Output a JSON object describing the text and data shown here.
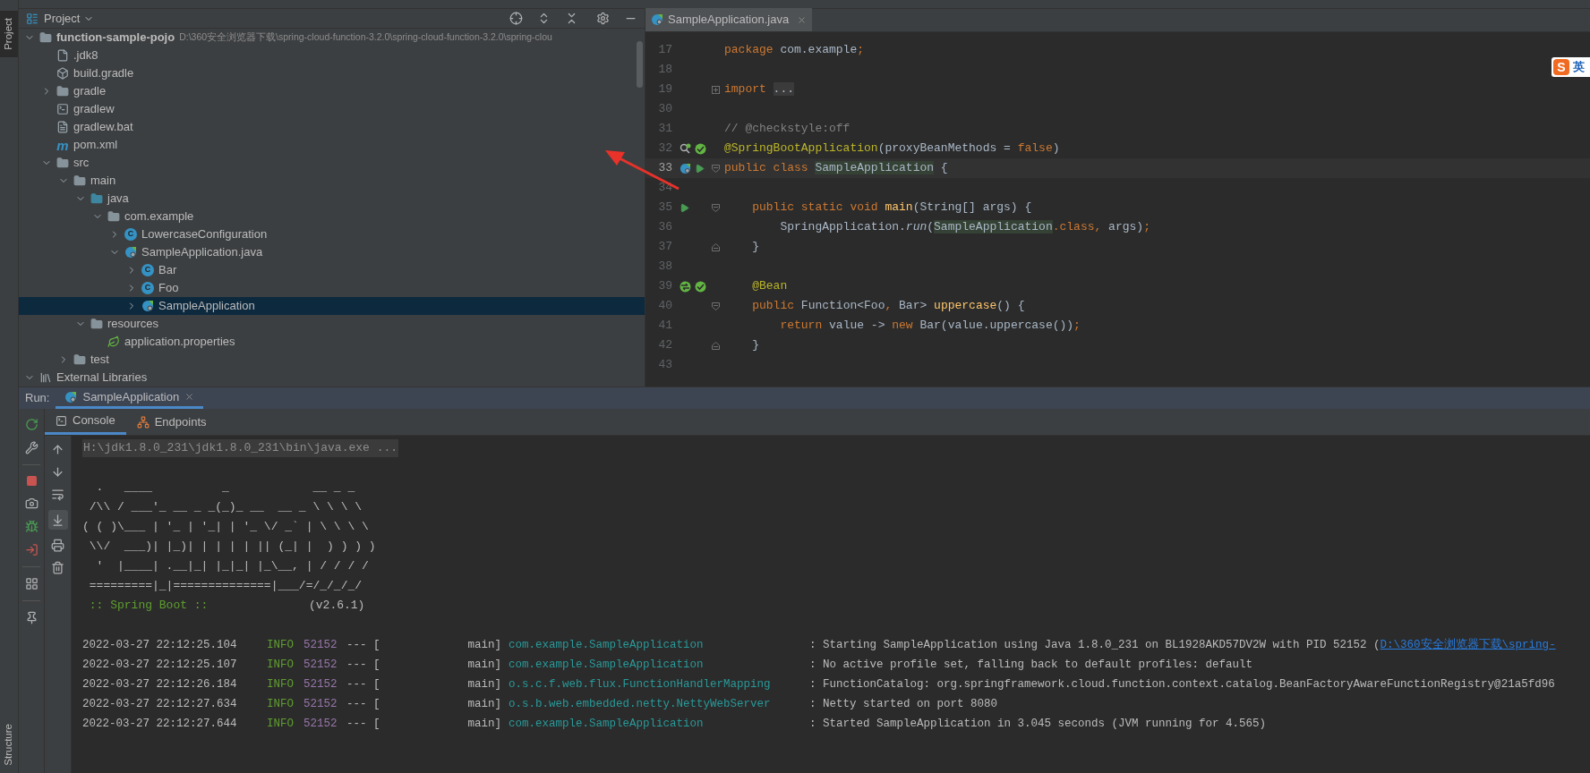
{
  "left_strip": {
    "top": [
      {
        "label": "Project",
        "selected": true
      }
    ],
    "bottom": [
      {
        "label": "Structure",
        "selected": false
      }
    ]
  },
  "project": {
    "title": "Project",
    "tree": [
      {
        "label": "function-sample-pojo",
        "kind": "module",
        "path": "D:\\360安全浏览器下载\\spring-cloud-function-3.2.0\\spring-cloud-function-3.2.0\\spring-clou",
        "expanded": true,
        "selected": false,
        "children": [
          {
            "label": ".jdk8",
            "kind": "sdk",
            "selected": false
          },
          {
            "label": "build.gradle",
            "kind": "gradle",
            "selected": false
          },
          {
            "label": "gradle",
            "kind": "folder",
            "expanded": false,
            "selected": false
          },
          {
            "label": "gradlew",
            "kind": "script",
            "selected": false
          },
          {
            "label": "gradlew.bat",
            "kind": "file",
            "selected": false
          },
          {
            "label": "pom.xml",
            "kind": "maven",
            "icon_letter": "m",
            "selected": false
          },
          {
            "label": "src",
            "kind": "folder",
            "expanded": true,
            "selected": false,
            "children": [
              {
                "label": "main",
                "kind": "folder",
                "expanded": true,
                "selected": false,
                "children": [
                  {
                    "label": "java",
                    "kind": "source-folder",
                    "expanded": true,
                    "selected": false,
                    "children": [
                      {
                        "label": "com.example",
                        "kind": "package",
                        "expanded": true,
                        "selected": false,
                        "children": [
                          {
                            "label": "LowercaseConfiguration",
                            "kind": "class",
                            "icon_letter": "C",
                            "expanded": false,
                            "selected": false
                          },
                          {
                            "label": "SampleApplication.java",
                            "kind": "spring-class",
                            "expanded": true,
                            "selected": false,
                            "children": [
                              {
                                "label": "Bar",
                                "kind": "class",
                                "icon_letter": "C",
                                "expanded": false,
                                "selected": false
                              },
                              {
                                "label": "Foo",
                                "kind": "class",
                                "icon_letter": "C",
                                "expanded": false,
                                "selected": false
                              },
                              {
                                "label": "SampleApplication",
                                "kind": "spring-class",
                                "expanded": false,
                                "selected": true
                              }
                            ]
                          }
                        ]
                      }
                    ]
                  },
                  {
                    "label": "resources",
                    "kind": "resources",
                    "expanded": true,
                    "selected": false,
                    "children": [
                      {
                        "label": "application.properties",
                        "kind": "properties",
                        "selected": false
                      }
                    ]
                  }
                ]
              },
              {
                "label": "test",
                "kind": "folder",
                "expanded": false,
                "selected": false
              }
            ]
          }
        ]
      },
      {
        "label": "External Libraries",
        "kind": "libraries",
        "expanded": true,
        "selected": false
      }
    ]
  },
  "editor": {
    "tabs": [
      {
        "label": "SampleApplication.java",
        "selected": true
      }
    ],
    "ime": {
      "logo": "S",
      "mode": "英"
    },
    "lines": [
      {
        "number": "17",
        "current": false,
        "tokens": [
          {
            "text": "package",
            "kind": "keyword"
          },
          {
            "text": " com.example",
            "kind": "plain"
          },
          {
            "text": ";",
            "kind": "keyword"
          }
        ]
      },
      {
        "number": "18",
        "current": false
      },
      {
        "number": "19",
        "current": false,
        "fold": {
          "kind": "collapsed"
        },
        "tokens": [
          {
            "text": "import ",
            "kind": "keyword"
          },
          {
            "text": "...",
            "kind": "folded"
          }
        ]
      },
      {
        "number": "30",
        "current": false
      },
      {
        "number": "31",
        "current": false,
        "tokens": [
          {
            "text": "// @checkstyle:off",
            "kind": "comment"
          }
        ]
      },
      {
        "number": "32",
        "current": false,
        "gutter": [
          {
            "kind": "bean-search"
          },
          {
            "kind": "bean"
          }
        ],
        "tokens": [
          {
            "text": "@SpringBootApplication",
            "kind": "annotation"
          },
          {
            "text": "(proxyBeanMethods = ",
            "kind": "plain"
          },
          {
            "text": "false",
            "kind": "keyword"
          },
          {
            "text": ")",
            "kind": "plain"
          }
        ]
      },
      {
        "number": "33",
        "current": true,
        "gutter": [
          {
            "kind": "spring-app"
          },
          {
            "kind": "run"
          }
        ],
        "fold": {
          "kind": "start"
        },
        "tokens": [
          {
            "text": "public class ",
            "kind": "keyword"
          },
          {
            "text": "SampleApplication",
            "kind": "highlight"
          },
          {
            "text": " {",
            "kind": "plain"
          }
        ]
      },
      {
        "number": "34",
        "current": false
      },
      {
        "number": "35",
        "current": false,
        "gutter": [
          {
            "kind": "run"
          }
        ],
        "fold": {
          "kind": "start"
        },
        "tokens": [
          {
            "text": "    public static void ",
            "kind": "keyword"
          },
          {
            "text": "main",
            "kind": "method"
          },
          {
            "text": "(String[] args) {",
            "kind": "plain"
          }
        ]
      },
      {
        "number": "36",
        "current": false,
        "tokens": [
          {
            "text": "        SpringApplication.",
            "kind": "plain"
          },
          {
            "text": "run",
            "kind": "italic"
          },
          {
            "text": "(",
            "kind": "plain"
          },
          {
            "text": "SampleApplication",
            "kind": "highlight"
          },
          {
            "text": ".class, ",
            "kind": "keyword"
          },
          {
            "text": "args)",
            "kind": "plain"
          },
          {
            "text": ";",
            "kind": "keyword"
          }
        ]
      },
      {
        "number": "37",
        "current": false,
        "fold": {
          "kind": "end"
        },
        "tokens": [
          {
            "text": "    }",
            "kind": "plain"
          }
        ]
      },
      {
        "number": "38",
        "current": false
      },
      {
        "number": "39",
        "current": false,
        "gutter": [
          {
            "kind": "bean-swap"
          },
          {
            "kind": "bean"
          }
        ],
        "tokens": [
          {
            "text": "    @Bean",
            "kind": "annotation"
          }
        ]
      },
      {
        "number": "40",
        "current": false,
        "fold": {
          "kind": "start"
        },
        "tokens": [
          {
            "text": "    public ",
            "kind": "keyword"
          },
          {
            "text": "Function<Foo",
            "kind": "plain"
          },
          {
            "text": ", ",
            "kind": "keyword"
          },
          {
            "text": "Bar> ",
            "kind": "plain"
          },
          {
            "text": "uppercase",
            "kind": "method"
          },
          {
            "text": "() {",
            "kind": "plain"
          }
        ]
      },
      {
        "number": "41",
        "current": false,
        "tokens": [
          {
            "text": "        return ",
            "kind": "keyword"
          },
          {
            "text": "value -> ",
            "kind": "plain"
          },
          {
            "text": "new ",
            "kind": "keyword"
          },
          {
            "text": "Bar(value.uppercase())",
            "kind": "plain"
          },
          {
            "text": ";",
            "kind": "keyword"
          }
        ]
      },
      {
        "number": "42",
        "current": false,
        "fold": {
          "kind": "end"
        },
        "tokens": [
          {
            "text": "    }",
            "kind": "plain"
          }
        ]
      },
      {
        "number": "43",
        "current": false
      }
    ]
  },
  "run": {
    "label": "Run:",
    "tabs": [
      {
        "label": "SampleApplication",
        "selected": true
      }
    ],
    "subtabs": [
      {
        "label": "Console",
        "kind": "console",
        "selected": true
      },
      {
        "label": "Endpoints",
        "kind": "endpoints",
        "selected": false
      }
    ],
    "autoscroll": true,
    "command": "H:\\jdk1.8.0_231\\jdk1.8.0_231\\bin\\java.exe ...",
    "banner": [
      "  .   ____          _            __ _ _",
      " /\\\\ / ___'_ __ _ _(_)_ __  __ _ \\ \\ \\ \\",
      "( ( )\\___ | '_ | '_| | '_ \\/ _` | \\ \\ \\ \\",
      " \\\\/  ___)| |_)| | | | | || (_| |  ) ) ) )",
      "  '  |____| .__|_| |_|_| |_\\__, | / / / /",
      " =========|_|==============|___/=/_/_/_/"
    ],
    "boot_label": " :: Spring Boot :: ",
    "boot_version": "(v2.6.1)",
    "log": [
      {
        "time": "2022-03-27 22:12:25.104",
        "level": "INFO",
        "pid": "52152",
        "sep": "--- [",
        "thread": "main]",
        "logger": "com.example.SampleApplication",
        "message": ": Starting SampleApplication using Java 1.8.0_231 on BL1928AKD57DV2W with PID 52152 (",
        "link": "D:\\360安全浏览器下载\\spring-"
      },
      {
        "time": "2022-03-27 22:12:25.107",
        "level": "INFO",
        "pid": "52152",
        "sep": "--- [",
        "thread": "main]",
        "logger": "com.example.SampleApplication",
        "message": ": No active profile set, falling back to default profiles: default"
      },
      {
        "time": "2022-03-27 22:12:26.184",
        "level": "INFO",
        "pid": "52152",
        "sep": "--- [",
        "thread": "main]",
        "logger": "o.s.c.f.web.flux.FunctionHandlerMapping",
        "message": ": FunctionCatalog: org.springframework.cloud.function.context.catalog.BeanFactoryAwareFunctionRegistry@21a5fd96"
      },
      {
        "time": "2022-03-27 22:12:27.634",
        "level": "INFO",
        "pid": "52152",
        "sep": "--- [",
        "thread": "main]",
        "logger": "o.s.b.web.embedded.netty.NettyWebServer",
        "message": ": Netty started on port 8080"
      },
      {
        "time": "2022-03-27 22:12:27.644",
        "level": "INFO",
        "pid": "52152",
        "sep": "--- [",
        "thread": "main]",
        "logger": "com.example.SampleApplication",
        "message": ": Started SampleApplication in 3.045 seconds (JVM running for 4.565)"
      }
    ]
  }
}
